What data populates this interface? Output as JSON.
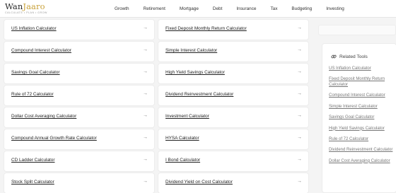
{
  "brand": {
    "name_main": "Wan",
    "name_accent": "Jaaro",
    "tagline": "CALCULATE • PLAN • GROW"
  },
  "nav": [
    "Growth",
    "Retirement",
    "Mortgage",
    "Debt",
    "Insurance",
    "Tax",
    "Budgeting",
    "Investing"
  ],
  "cards": [
    "US Inflation Calculator",
    "Fixed Deposit Monthly Return Calculator",
    "Compound Interest Calculator",
    "Simple Interest Calculator",
    "Savings Goal Calculator",
    "High Yield Savings Calculator",
    "Rule of 72 Calculator",
    "Dividend Reinvestment Calculator",
    "Dollar Cost Averaging Calculator",
    "Investment Calculator",
    "Compound Annual Growth Rate Calculator",
    "HYSA Calculator",
    "CD Ladder Calculator",
    "I Bond Calculator",
    "Stock Split Calculator",
    "Dividend Yield on Cost Calculator"
  ],
  "arrow_glyph": "→",
  "sidebar": {
    "title": "Related Tools",
    "items": [
      "US Inflation Calculator",
      "Fixed Deposit Monthly Return Calculator",
      "Compound Interest Calculator",
      "Simple Interest Calculator",
      "Savings Goal Calculator",
      "High Yield Savings Calculator",
      "Rule of 72 Calculator",
      "Dividend Reinvestment Calculator",
      "Dollar Cost Averaging Calculator"
    ]
  },
  "colors": {
    "accent": "#c9a23a",
    "text": "#222222",
    "muted": "#777777",
    "background": "#f4f4f4"
  }
}
